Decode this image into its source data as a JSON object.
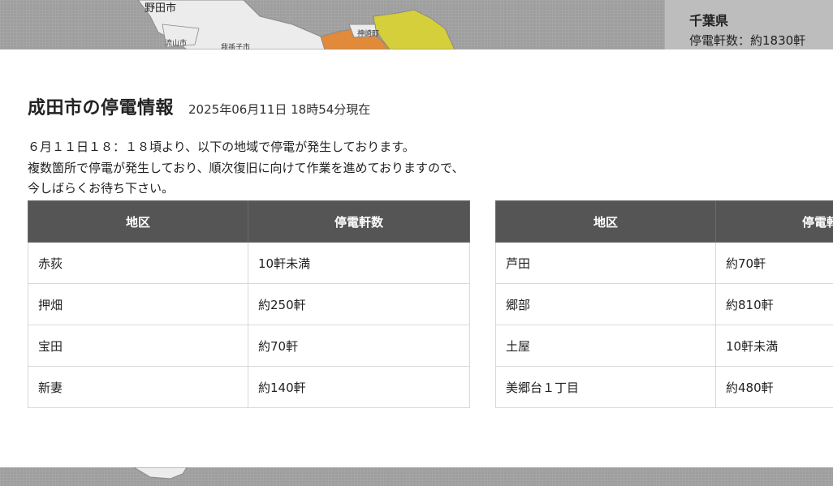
{
  "background": {
    "map_labels": {
      "city_noda": "野田市",
      "city_nagareyama": "流山市",
      "city_abiko": "我孫子市",
      "town_kozaki": "神崎町",
      "city_narita": "千葉県"
    },
    "region_panel": {
      "prefecture": "千葉県",
      "outage_count": "停電軒数：約1830軒"
    },
    "colors": {
      "map_base": "#9e9e9e",
      "map_land": "#ececec",
      "area_orange": "#e08a3a",
      "area_yellow": "#d4cf3a"
    }
  },
  "modal": {
    "title": "成田市の停電情報",
    "timestamp": "2025年06月11日 18時54分現在",
    "notice_lines": [
      "６月１１日１８：１８頃より、以下の地域で停電が発生しております。",
      "複数箇所で停電が発生しており、順次復旧に向けて作業を進めておりますので、",
      "今しばらくお待ち下さい。"
    ],
    "tables": [
      {
        "headers": [
          "地区",
          "停電軒数"
        ],
        "rows": [
          [
            "赤荻",
            "10軒未満"
          ],
          [
            "押畑",
            "約250軒"
          ],
          [
            "宝田",
            "約70軒"
          ],
          [
            "新妻",
            "約140軒"
          ]
        ]
      },
      {
        "headers": [
          "地区",
          "停電軒数"
        ],
        "rows": [
          [
            "芦田",
            "約70軒"
          ],
          [
            "郷部",
            "約810軒"
          ],
          [
            "土屋",
            "10軒未満"
          ],
          [
            "美郷台１丁目",
            "約480軒"
          ]
        ]
      }
    ],
    "colors": {
      "header_bg": "#555555",
      "header_text": "#ffffff",
      "border": "#d9d9d9"
    }
  }
}
